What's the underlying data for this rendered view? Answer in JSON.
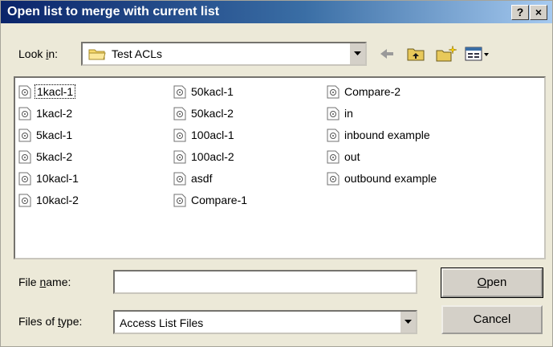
{
  "window": {
    "title": "Open list to merge with current list",
    "help_label": "?",
    "close_label": "×"
  },
  "lookin": {
    "label_pre": "Look ",
    "label_accel": "i",
    "label_post": "n:",
    "value": "Test ACLs"
  },
  "toolbar": {
    "icons": [
      "back-icon",
      "up-one-level-icon",
      "new-folder-icon",
      "view-menu-icon"
    ]
  },
  "files": [
    "1kacl-1",
    "1kacl-2",
    "5kacl-1",
    "5kacl-2",
    "10kacl-1",
    "10kacl-2",
    "50kacl-1",
    "50kacl-2",
    "100acl-1",
    "100acl-2",
    "asdf",
    "Compare-1",
    "Compare-2",
    "in",
    "inbound example",
    "out",
    "outbound example"
  ],
  "filename": {
    "label_pre": "File ",
    "label_accel": "n",
    "label_post": "ame:",
    "value": ""
  },
  "filetype": {
    "label_pre": "Files of ",
    "label_accel": "t",
    "label_post": "ype:",
    "value": "Access List Files"
  },
  "buttons": {
    "open_accel": "O",
    "open_rest": "pen",
    "cancel": "Cancel"
  }
}
